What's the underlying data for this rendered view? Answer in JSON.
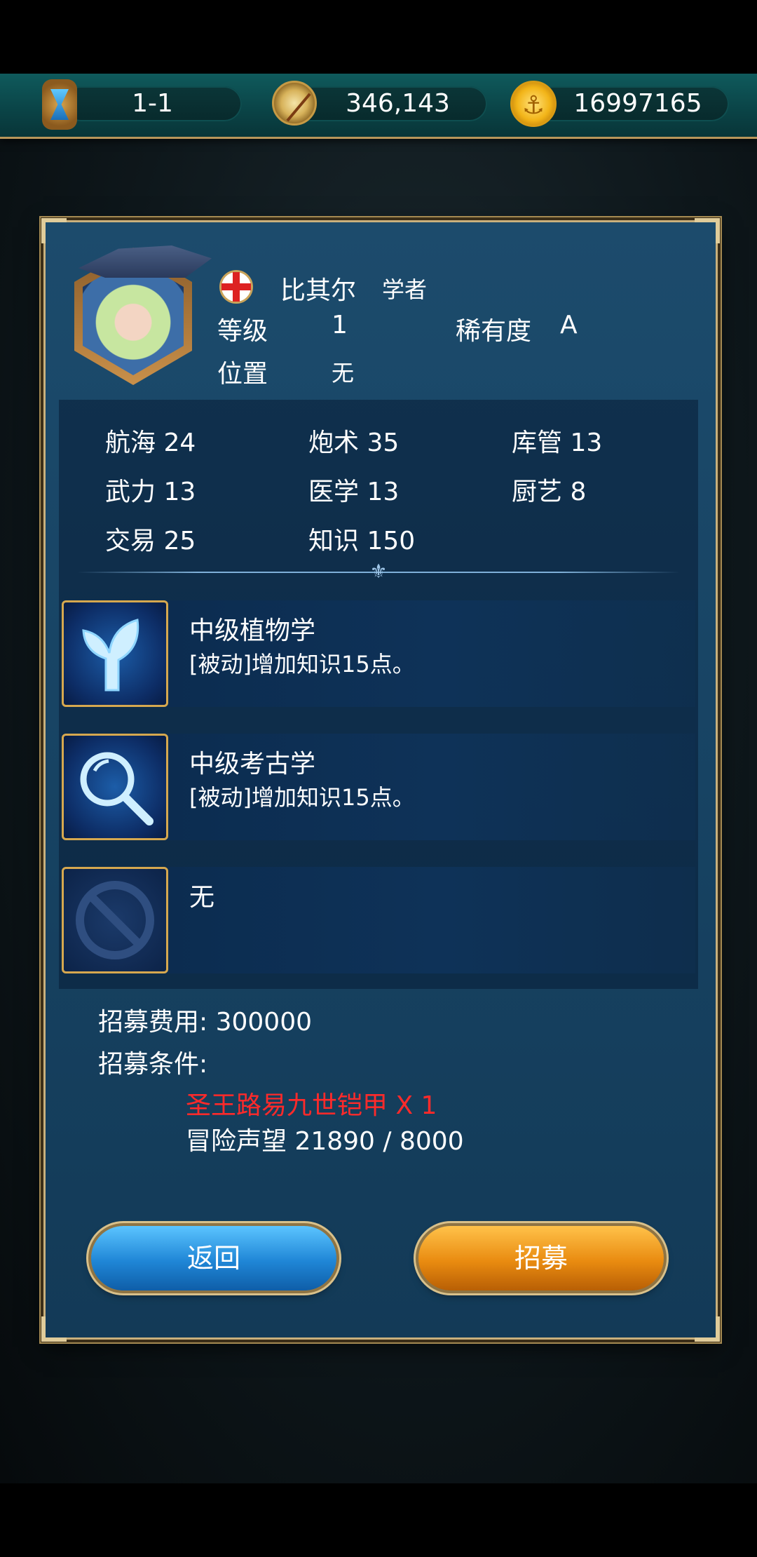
{
  "topbar": {
    "stage": "1-1",
    "compass_value": "346,143",
    "gold_value": "16997165",
    "icons": [
      "hourglass-icon",
      "compass-icon",
      "gold-coin-icon"
    ]
  },
  "character": {
    "name": "比其尔",
    "title": "学者",
    "flag_icon": "england-flag-icon",
    "level_label": "等级",
    "level_value": "1",
    "rarity_label": "稀有度",
    "rarity_value": "A",
    "position_label": "位置",
    "position_value": "无"
  },
  "stats": [
    {
      "label": "航海",
      "value": "24"
    },
    {
      "label": "炮术",
      "value": "35"
    },
    {
      "label": "库管",
      "value": "13"
    },
    {
      "label": "武力",
      "value": "13"
    },
    {
      "label": "医学",
      "value": "13"
    },
    {
      "label": "厨艺",
      "value": "8"
    },
    {
      "label": "交易",
      "value": "25"
    },
    {
      "label": "知识",
      "value": "150"
    }
  ],
  "skills": [
    {
      "name": "中级植物学",
      "desc": "[被动]增加知识15点。",
      "icon": "plant-icon"
    },
    {
      "name": "中级考古学",
      "desc": "[被动]增加知识15点。",
      "icon": "magnifier-icon"
    },
    {
      "name": "无",
      "desc": "",
      "icon": "prohibited-icon"
    }
  ],
  "recruit": {
    "cost_label": "招募费用: 300000",
    "conditions_label": "招募条件:",
    "condition_1": "圣王路易九世铠甲 X 1",
    "condition_2": "冒险声望 21890 / 8000"
  },
  "buttons": {
    "back": "返回",
    "recruit": "招募"
  },
  "colors": {
    "panel": "#174363",
    "border_gold": "#c9b07c",
    "condition_unmet": "#ff2a2a",
    "back_button": "#1f86d6",
    "recruit_button": "#e98b10"
  }
}
